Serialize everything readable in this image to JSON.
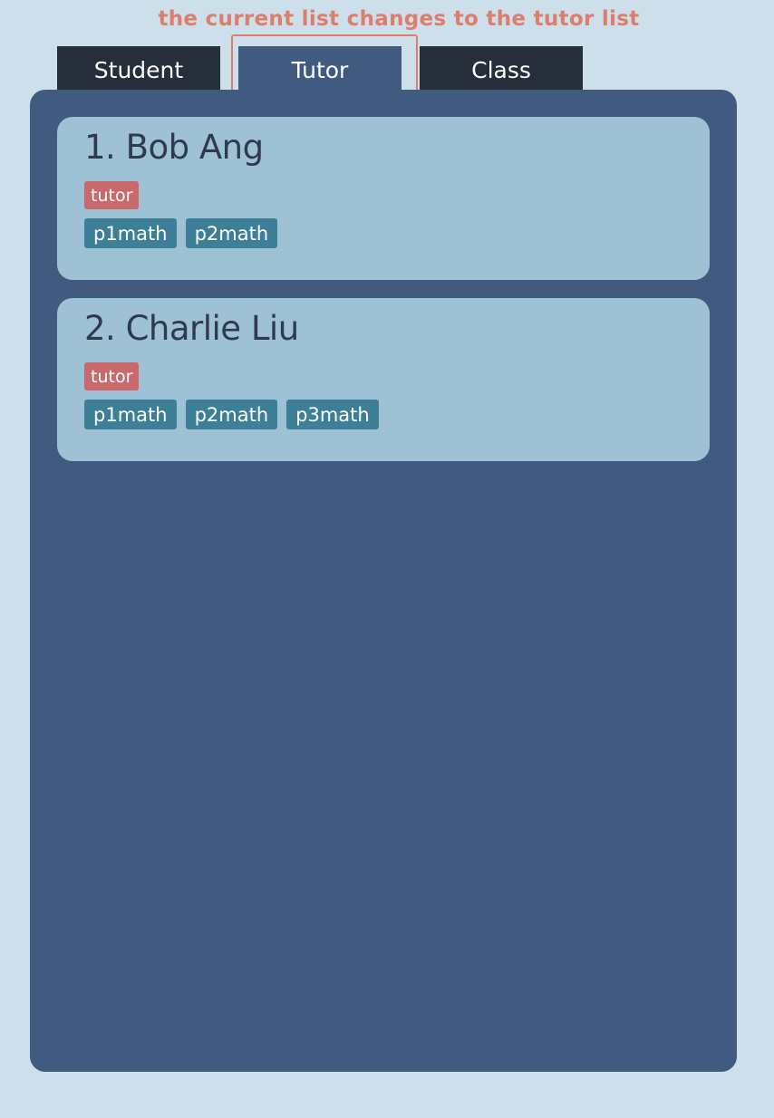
{
  "annotation": {
    "text": "the current list changes to the tutor list",
    "color": "#dd7e6b"
  },
  "tabs": [
    {
      "label": "Student",
      "active": false
    },
    {
      "label": "Tutor",
      "active": true
    },
    {
      "label": "Class",
      "active": false
    }
  ],
  "tutors": [
    {
      "name": "1. Bob Ang",
      "role": "tutor",
      "tags": [
        "p1math",
        "p2math"
      ]
    },
    {
      "name": "2. Charlie Liu",
      "role": "tutor",
      "tags": [
        "p1math",
        "p2math",
        "p3math"
      ]
    }
  ],
  "colors": {
    "background": "#cddfea",
    "panel": "#415b80",
    "card": "#9fc1d6",
    "inactive_tab": "#272e3b",
    "active_tab": "#415b80",
    "role_badge": "#c9696b",
    "subject_tag": "#3d7f96"
  }
}
